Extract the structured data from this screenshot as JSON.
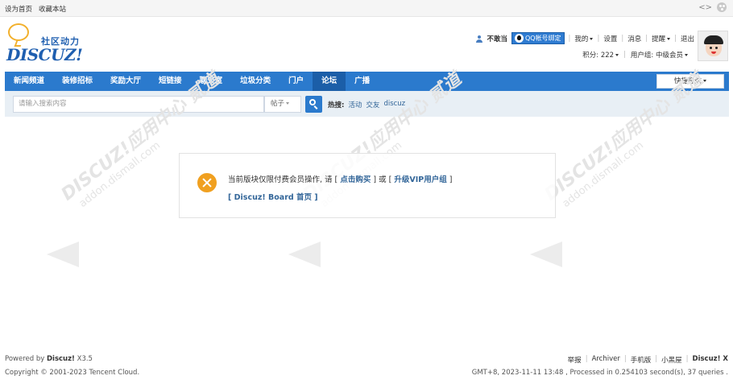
{
  "topbar": {
    "set_home": "设为首页",
    "bookmark": "收藏本站",
    "arrows": "<>",
    "style_icon": "palette-icon"
  },
  "logo": {
    "cn": "社区动力",
    "en": "DISCUZ!"
  },
  "user": {
    "name": "不敢当",
    "qq_bind": "QQ帐号绑定",
    "mine": "我的",
    "settings": "设置",
    "messages": "消息",
    "remind": "提醒",
    "logout": "退出",
    "points": "积分: 222",
    "group": "用户组: 中级会员"
  },
  "nav": {
    "items": [
      {
        "label": "新闻频道"
      },
      {
        "label": "装修招标"
      },
      {
        "label": "奖励大厅"
      },
      {
        "label": "短链接"
      },
      {
        "label": "聊天室"
      },
      {
        "label": "垃圾分类"
      },
      {
        "label": "门户"
      },
      {
        "label": "论坛"
      },
      {
        "label": "广播"
      }
    ],
    "active_index": 7,
    "quick_nav": "快捷导航"
  },
  "search": {
    "placeholder": "请输入搜索内容",
    "type": "帖子",
    "hot_label": "热搜:",
    "hot": [
      "活动",
      "交友",
      "discuz"
    ]
  },
  "watermark": {
    "line1": "DISCUZ!应用中心",
    "line2": "addon.dismall.com",
    "mark": "贰道"
  },
  "message": {
    "prefix": "当前版块仅限付费会员操作, 请 [",
    "buy": "点击购买",
    "middle": "] 或 [",
    "upgrade": "升级VIP用户组",
    "suffix": "]",
    "back_link": "[ Discuz! Board 首页 ]"
  },
  "footer": {
    "powered_prefix": "Powered by",
    "powered_brand": "Discuz!",
    "powered_version": "X3.5",
    "copyright": "Copyright © 2001-2023 Tencent Cloud.",
    "links": [
      "举报",
      "Archiver",
      "手机版",
      "小黑屋"
    ],
    "brand": "Discuz! X",
    "stats": "GMT+8, 2023-11-11 13:48 , Processed in 0.254103 second(s), 37 queries ."
  },
  "colors": {
    "nav_bg": "#2b7acd",
    "nav_active": "#1b5ea8",
    "search_bg": "#e8eff5",
    "link": "#336699",
    "error_icon": "#f0a020"
  }
}
